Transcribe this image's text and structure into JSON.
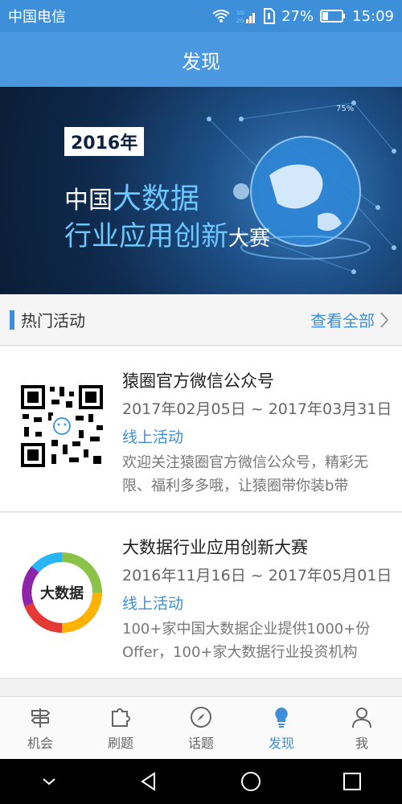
{
  "statusbar": {
    "carrier": "中国电信",
    "network": "3G 2G",
    "battery": "27%",
    "time": "15:09"
  },
  "header": {
    "title": "发现"
  },
  "banner": {
    "year": "2016年",
    "line1_prefix": "中国",
    "line1_highlight": "大数据",
    "line2_main": "行业应用创新",
    "line2_suffix": "大赛"
  },
  "section": {
    "title": "热门活动",
    "more": "查看全部"
  },
  "activities": [
    {
      "name": "猿圈官方微信公众号",
      "date": "2017年02月05日 ~ 2017年03月31日",
      "type": "线上活动",
      "desc": "欢迎关注猿圈官方微信公众号，精彩无限、福利多多哦，让猿圈带你装b带"
    },
    {
      "name": "大数据行业应用创新大赛",
      "date": "2016年11月16日 ~ 2017年05月01日",
      "type": "线上活动",
      "desc": "100+家中国大数据企业提供1000+份Offer，100+家大数据行业投资机构",
      "logo_text": "大数据"
    }
  ],
  "nav": [
    {
      "label": "机会",
      "icon": "signpost-icon"
    },
    {
      "label": "刷题",
      "icon": "puzzle-icon"
    },
    {
      "label": "话题",
      "icon": "compass-icon"
    },
    {
      "label": "发现",
      "icon": "lightbulb-icon"
    },
    {
      "label": "我",
      "icon": "person-icon"
    }
  ],
  "colors": {
    "primary": "#3d8fd9",
    "titlebar": "#4a99e0"
  }
}
